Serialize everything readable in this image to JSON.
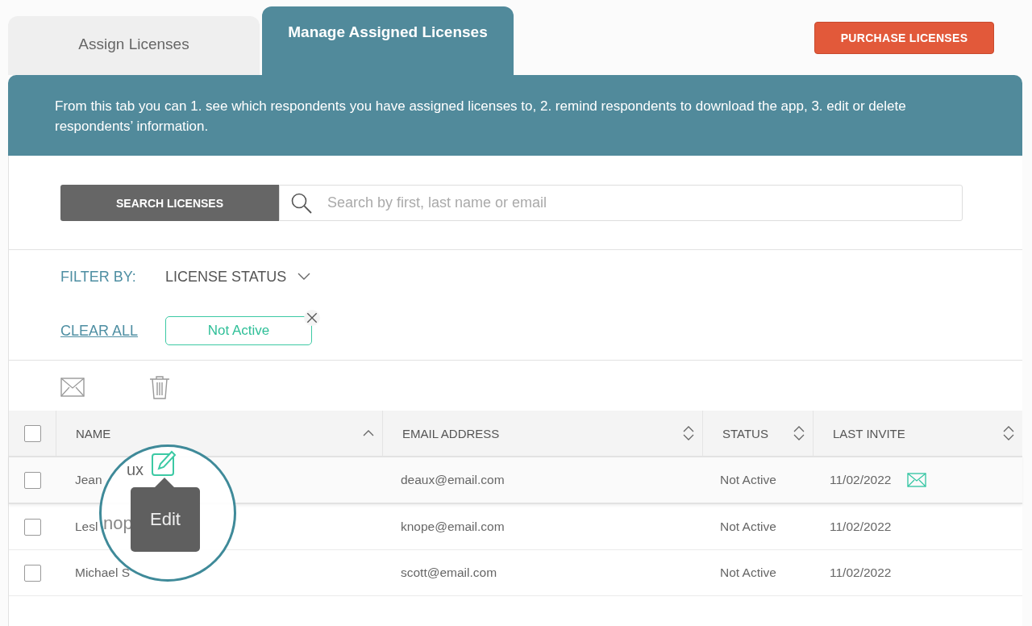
{
  "tabs": [
    {
      "label": "Assign Licenses",
      "selected": false
    },
    {
      "label": "Manage Assigned Licenses",
      "selected": true
    }
  ],
  "purchase_button": "PURCHASE LICENSES",
  "info_text": "From this tab you can 1. see which respondents you have assigned licenses to, 2. remind respondents to download the app, 3. edit or delete respondents’ information.",
  "search": {
    "button": "SEARCH LICENSES",
    "placeholder": "Search by first, last name or email"
  },
  "filter": {
    "label": "FILTER BY:",
    "dropdown": "LICENSE STATUS",
    "clear_all": "CLEAR ALL",
    "chips": [
      {
        "label": "Not Active"
      }
    ]
  },
  "table": {
    "header_checked": false,
    "columns": [
      {
        "label": "NAME",
        "sorted": true
      },
      {
        "label": "EMAIL ADDRESS",
        "sorted": false
      },
      {
        "label": "STATUS",
        "sorted": false
      },
      {
        "label": "LAST INVITE",
        "sorted": false
      }
    ],
    "rows": [
      {
        "checked": false,
        "highlighted": true,
        "invite_icon": true,
        "name": "Jean",
        "email": "deaux@email.com",
        "status": "Not Active",
        "last_invite": "11/02/2022"
      },
      {
        "checked": false,
        "highlighted": false,
        "invite_icon": false,
        "name": "Lesl",
        "email": "knope@email.com",
        "status": "Not Active",
        "last_invite": "11/02/2022"
      },
      {
        "checked": false,
        "highlighted": false,
        "invite_icon": false,
        "name": "Michael S",
        "email": "scott@email.com",
        "status": "Not Active",
        "last_invite": "11/02/2022"
      }
    ]
  },
  "magnifier": {
    "texts": [
      "ux",
      "nop"
    ],
    "tooltip": "Edit"
  }
}
